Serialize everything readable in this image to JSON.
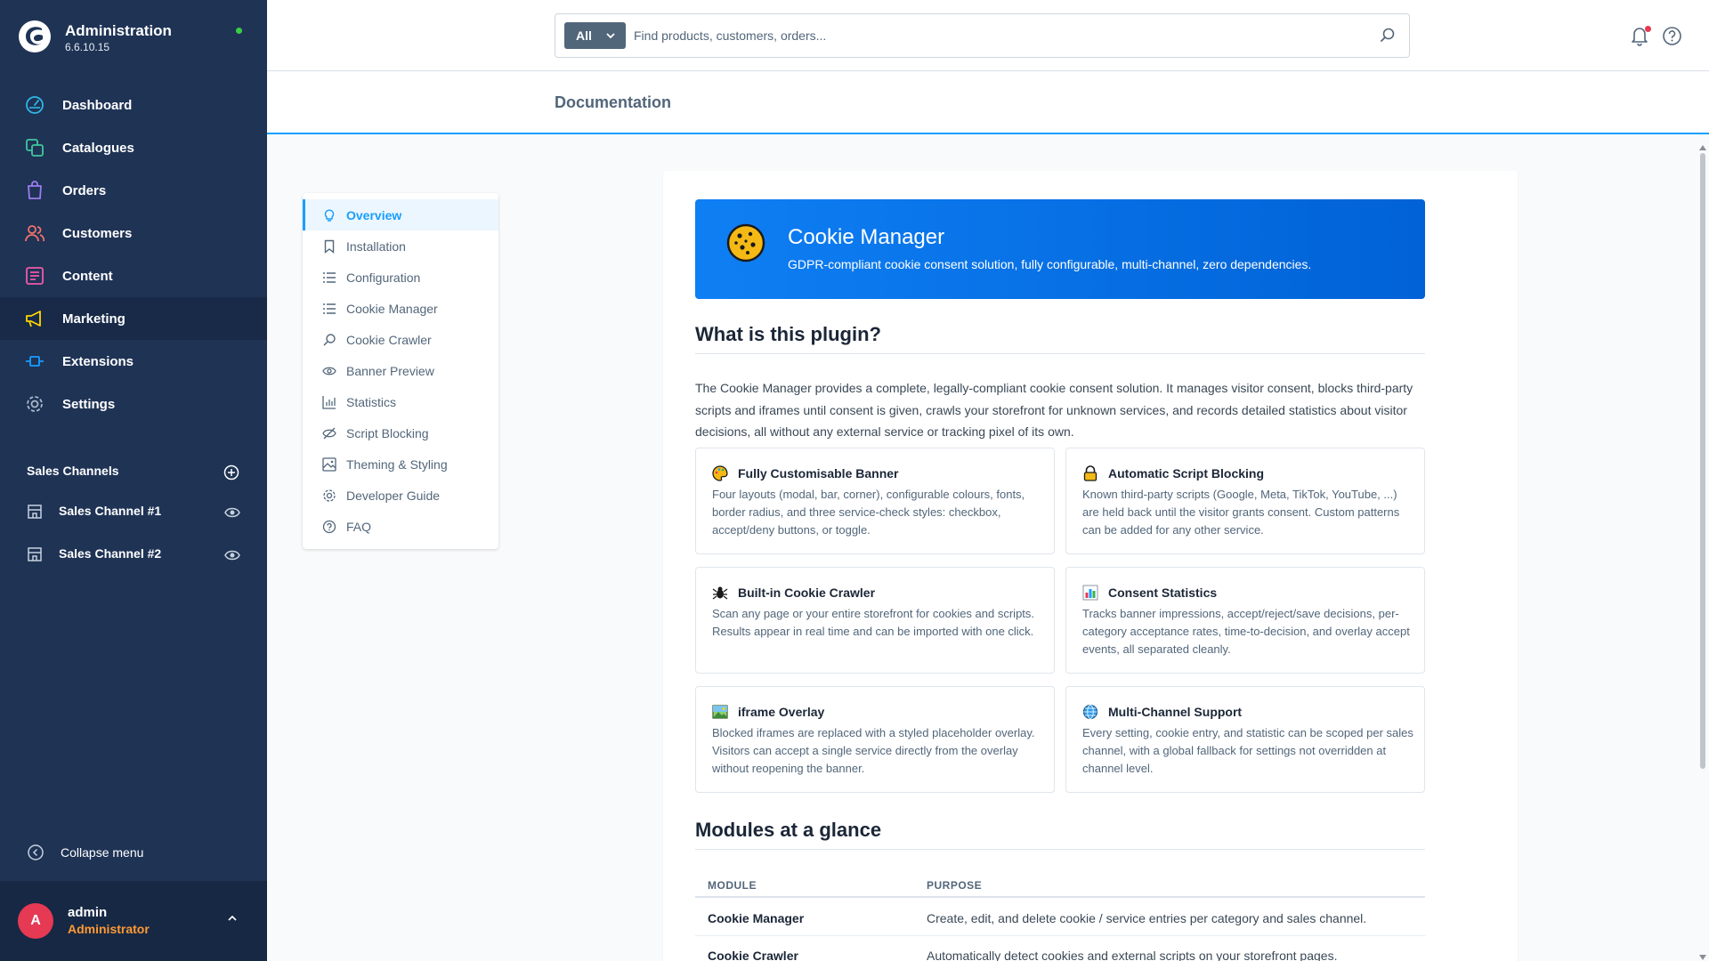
{
  "app": {
    "title": "Administration",
    "version": "6.6.10.15"
  },
  "sidebar": {
    "items": [
      {
        "label": "Dashboard",
        "icon": "dashboard-icon"
      },
      {
        "label": "Catalogues",
        "icon": "catalogue-icon"
      },
      {
        "label": "Orders",
        "icon": "orders-icon"
      },
      {
        "label": "Customers",
        "icon": "customers-icon"
      },
      {
        "label": "Content",
        "icon": "content-icon"
      },
      {
        "label": "Marketing",
        "icon": "marketing-icon",
        "active": true
      },
      {
        "label": "Extensions",
        "icon": "extensions-icon"
      },
      {
        "label": "Settings",
        "icon": "settings-icon"
      }
    ],
    "channels_title": "Sales Channels",
    "channels": [
      {
        "label": "Sales Channel #1"
      },
      {
        "label": "Sales Channel #2"
      }
    ],
    "collapse_label": "Collapse menu",
    "user": {
      "initial": "A",
      "name": "admin",
      "role": "Administrator"
    }
  },
  "search": {
    "type_label": "All",
    "placeholder": "Find products, customers, orders..."
  },
  "page": {
    "title": "Documentation"
  },
  "docnav": {
    "items": [
      {
        "label": "Overview",
        "active": true
      },
      {
        "label": "Installation"
      },
      {
        "label": "Configuration"
      },
      {
        "label": "Cookie Manager"
      },
      {
        "label": "Cookie Crawler"
      },
      {
        "label": "Banner Preview"
      },
      {
        "label": "Statistics"
      },
      {
        "label": "Script Blocking"
      },
      {
        "label": "Theming & Styling"
      },
      {
        "label": "Developer Guide"
      },
      {
        "label": "FAQ"
      }
    ]
  },
  "doc": {
    "hero": {
      "title": "Cookie Manager",
      "subtitle": "GDPR-compliant cookie consent solution, fully configurable, multi-channel, zero dependencies."
    },
    "what_title": "What is this plugin?",
    "intro": "The Cookie Manager provides a complete, legally-compliant cookie consent solution. It manages visitor consent, blocks third-party scripts and iframes until consent is given, crawls your storefront for unknown services, and records detailed statistics about visitor decisions, all without any external service or tracking pixel of its own.",
    "features": [
      {
        "title": "Fully Customisable Banner",
        "icon": "palette-icon",
        "text": "Four layouts (modal, bar, corner), configurable colours, fonts, border radius, and three service-check styles: checkbox, accept/deny buttons, or toggle."
      },
      {
        "title": "Automatic Script Blocking",
        "icon": "lock-icon",
        "text": "Known third-party scripts (Google, Meta, TikTok, YouTube, ...) are held back until the visitor grants consent. Custom patterns can be added for any other service."
      },
      {
        "title": "Built-in Cookie Crawler",
        "icon": "spider-icon",
        "text": "Scan any page or your entire storefront for cookies and scripts. Results appear in real time and can be imported with one click."
      },
      {
        "title": "Consent Statistics",
        "icon": "bar-chart-icon",
        "text": "Tracks banner impressions, accept/reject/save decisions, per-category acceptance rates, time-to-decision, and overlay accept events, all separated cleanly."
      },
      {
        "title": "iframe Overlay",
        "icon": "picture-icon",
        "text": "Blocked iframes are replaced with a styled placeholder overlay. Visitors can accept a single service directly from the overlay without reopening the banner."
      },
      {
        "title": "Multi-Channel Support",
        "icon": "globe-icon",
        "text": "Every setting, cookie entry, and statistic can be scoped per sales channel, with a global fallback for settings not overridden at channel level."
      }
    ],
    "modules_title": "Modules at a glance",
    "table": {
      "headers": [
        "MODULE",
        "PURPOSE"
      ],
      "rows": [
        {
          "module": "Cookie Manager",
          "purpose": "Create, edit, and delete cookie / service entries per category and sales channel."
        },
        {
          "module": "Cookie Crawler",
          "purpose": "Automatically detect cookies and external scripts on your storefront pages."
        }
      ]
    }
  },
  "colors": {
    "sidebar_bg": "#1f3355",
    "accent": "#189eff",
    "hero_bg": "#0b74e6",
    "avatar_bg": "#e63953",
    "role": "#ff9a35"
  }
}
